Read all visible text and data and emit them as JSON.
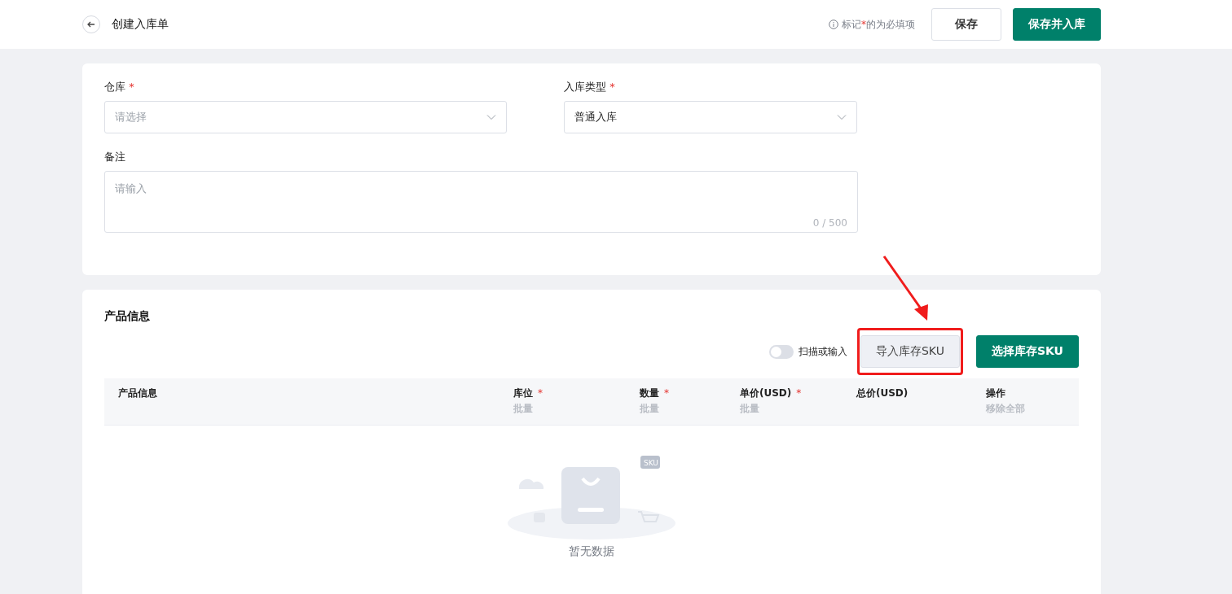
{
  "header": {
    "title": "创建入库单",
    "hint": [
      "标记",
      "*",
      "的为必填项"
    ],
    "buttons": [
      {
        "label": "保存",
        "kind": "secondary"
      },
      {
        "label": "保存并入库",
        "kind": "primary"
      }
    ]
  },
  "form": {
    "fields": [
      {
        "label": "仓库",
        "mark": "*",
        "kind": "select",
        "placeholder": "请选择"
      },
      {
        "label": "入库类型",
        "mark": "*",
        "kind": "select",
        "value": "普通入库"
      }
    ],
    "remark": {
      "label": "备注",
      "placeholder": "请输入",
      "counter": "0 / 500"
    }
  },
  "products": {
    "title": "产品信息",
    "scan_toggle": {
      "label": "扫描或输入",
      "on": false
    },
    "buttons": [
      {
        "label": "导入库存SKU",
        "kind": "secondary",
        "highlighted": true
      },
      {
        "label": "选择库存SKU",
        "kind": "primary",
        "highlighted": false
      }
    ],
    "columns": [
      {
        "label": "产品信息"
      },
      {
        "label": "库位",
        "mark": "*",
        "sub": "批量"
      },
      {
        "label": "数量",
        "mark": "*",
        "sub": "批量"
      },
      {
        "label": "单价(USD)",
        "mark": "*",
        "sub": "批量"
      },
      {
        "label": "总价(USD)"
      },
      {
        "label": "操作",
        "sub": "移除全部"
      }
    ],
    "empty": {
      "text": "暂无数据",
      "badge": "SKU"
    }
  }
}
